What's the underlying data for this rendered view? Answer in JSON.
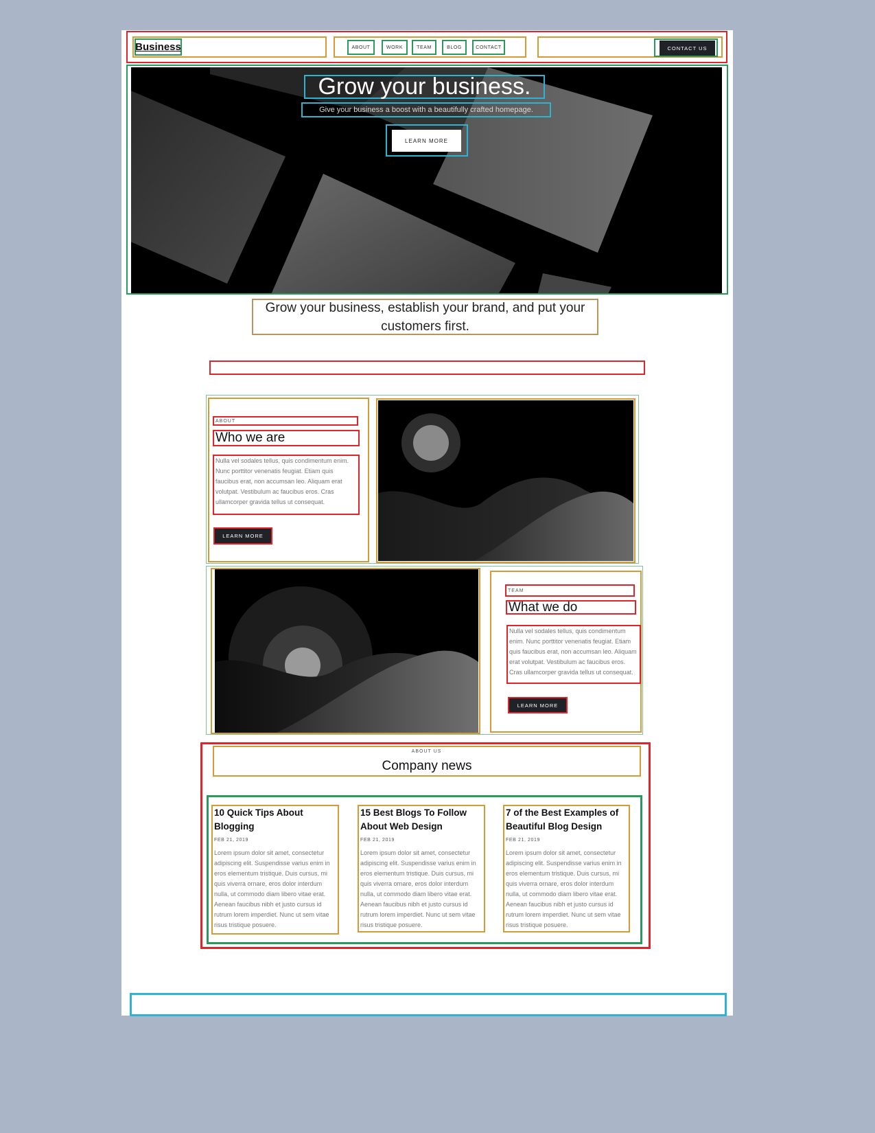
{
  "header": {
    "logo": "Business",
    "nav": [
      "ABOUT",
      "WORK",
      "TEAM",
      "BLOG",
      "CONTACT"
    ],
    "cta": "CONTACT US"
  },
  "hero": {
    "title": "Grow your business.",
    "subtitle": "Give your business a boost with a beautifully crafted homepage.",
    "button": "LEARN MORE"
  },
  "tagline": "Grow your business, establish your brand, and put your customers first.",
  "about": {
    "eyebrow": "ABOUT",
    "heading": "Who we are",
    "text": "Nulla vel sodales tellus, quis condimentum enim. Nunc porttitor venenatis feugiat. Etiam quis faucibus erat, non accumsan leo. Aliquam erat volutpat. Vestibulum ac faucibus eros. Cras ullamcorper gravida tellus ut consequat.",
    "button": "LEARN MORE"
  },
  "team": {
    "eyebrow": "TEAM",
    "heading": "What we do",
    "text": "Nulla vel sodales tellus, quis condimentum enim. Nunc porttitor venenatis feugiat. Etiam quis faucibus erat, non accumsan leo. Aliquam erat volutpat. Vestibulum ac faucibus eros. Cras ullamcorper gravida tellus ut consequat.",
    "button": "LEARN MORE"
  },
  "news": {
    "eyebrow": "ABOUT US",
    "title": "Company news",
    "posts": [
      {
        "title": "10 Quick Tips About Blogging",
        "date": "FEB 21, 2019",
        "body": "Lorem ipsum dolor sit amet, consectetur adipiscing elit. Suspendisse varius enim in eros elementum tristique. Duis cursus, mi quis viverra ornare, eros dolor interdum nulla, ut commodo diam libero vitae erat. Aenean faucibus nibh et justo cursus id rutrum lorem imperdiet. Nunc ut sem vitae risus tristique posuere."
      },
      {
        "title": "15 Best Blogs To Follow About Web Design",
        "date": "FEB 21, 2019",
        "body": "Lorem ipsum dolor sit amet, consectetur adipiscing elit. Suspendisse varius enim in eros elementum tristique. Duis cursus, mi quis viverra ornare, eros dolor interdum nulla, ut commodo diam libero vitae erat. Aenean faucibus nibh et justo cursus id rutrum lorem imperdiet. Nunc ut sem vitae risus tristique posuere."
      },
      {
        "title": "7 of the Best Examples of Beautiful Blog Design",
        "date": "FEB 21, 2019",
        "body": "Lorem ipsum dolor sit amet, consectetur adipiscing elit. Suspendisse varius enim in eros elementum tristique. Duis cursus, mi quis viverra ornare, eros dolor interdum nulla, ut commodo diam libero vitae erat. Aenean faucibus nibh et justo cursus id rutrum lorem imperdiet. Nunc ut sem vitae risus tristique posuere."
      }
    ]
  },
  "colors": {
    "page_bg": "#aab6c8",
    "button_dark": "#1f2227",
    "outline_red": "#e0242a",
    "outline_green": "#2a9a5c",
    "outline_gold": "#d59a33",
    "outline_cyan": "#2fb3d2"
  }
}
